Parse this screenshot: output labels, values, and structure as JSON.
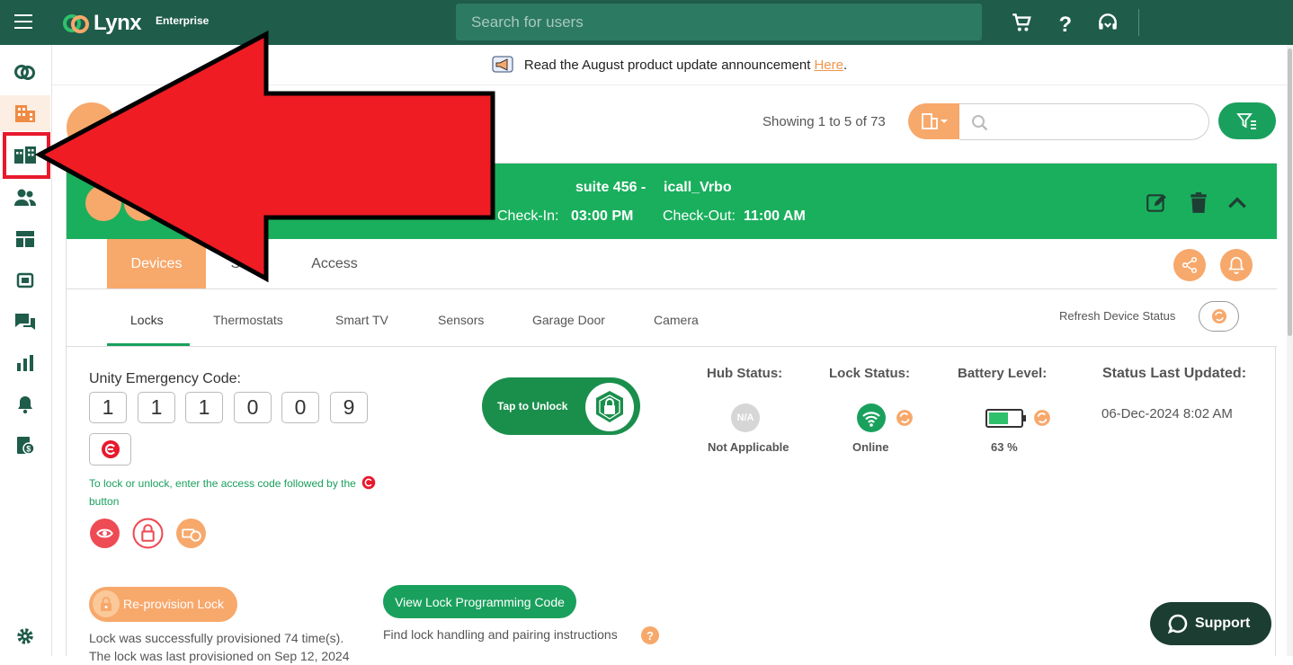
{
  "app": {
    "name": "Lynx",
    "edition": "Enterprise"
  },
  "header": {
    "search_placeholder": "Search for users"
  },
  "announcement": {
    "text": "Read the August product update announcement",
    "link": "Here",
    "suffix": "."
  },
  "list": {
    "showing": "Showing 1 to 5 of 73"
  },
  "booking": {
    "suite": "suite 456 -",
    "source": "icall_Vrbo",
    "checkin_label": "Check-In:",
    "checkin_time": "03:00 PM",
    "checkout_label": "Check-Out:",
    "checkout_time": "11:00 AM"
  },
  "tabs": [
    {
      "label": "Devices"
    },
    {
      "label": "S"
    },
    {
      "label": "Access"
    }
  ],
  "subtabs": [
    {
      "label": "Locks"
    },
    {
      "label": "Thermostats"
    },
    {
      "label": "Smart TV"
    },
    {
      "label": "Sensors"
    },
    {
      "label": "Garage Door"
    },
    {
      "label": "Camera"
    }
  ],
  "refresh_label": "Refresh Device Status",
  "lock": {
    "emergency_label": "Unity Emergency Code:",
    "code": [
      "1",
      "1",
      "1",
      "0",
      "0",
      "9"
    ],
    "instruction_main": "To lock or unlock, enter the access code followed by the",
    "instruction_end": "button",
    "tap_unlock": "Tap to Unlock",
    "reprovision": "Re-provision Lock",
    "view_code": "View Lock Programming Code",
    "provisioned_line1": "Lock was successfully provisioned 74 time(s).",
    "provisioned_line2": "The lock was last provisioned on Sep 12, 2024",
    "find_instructions": "Find lock handling and pairing instructions",
    "help": "?"
  },
  "status": {
    "hub_label": "Hub Status:",
    "hub_badge": "N/A",
    "hub_value": "Not Applicable",
    "lock_label": "Lock Status:",
    "lock_value": "Online",
    "battery_label": "Battery Level:",
    "battery_value": "63 %",
    "battery_level": 0.63,
    "updated_label": "Status Last Updated:",
    "updated_value": "06-Dec-2024 8:02 AM"
  },
  "support": "Support",
  "colors": {
    "primary": "#1f5c4a",
    "green": "#1aaf5d",
    "orange": "#f7a86b",
    "red": "#e8192c"
  }
}
